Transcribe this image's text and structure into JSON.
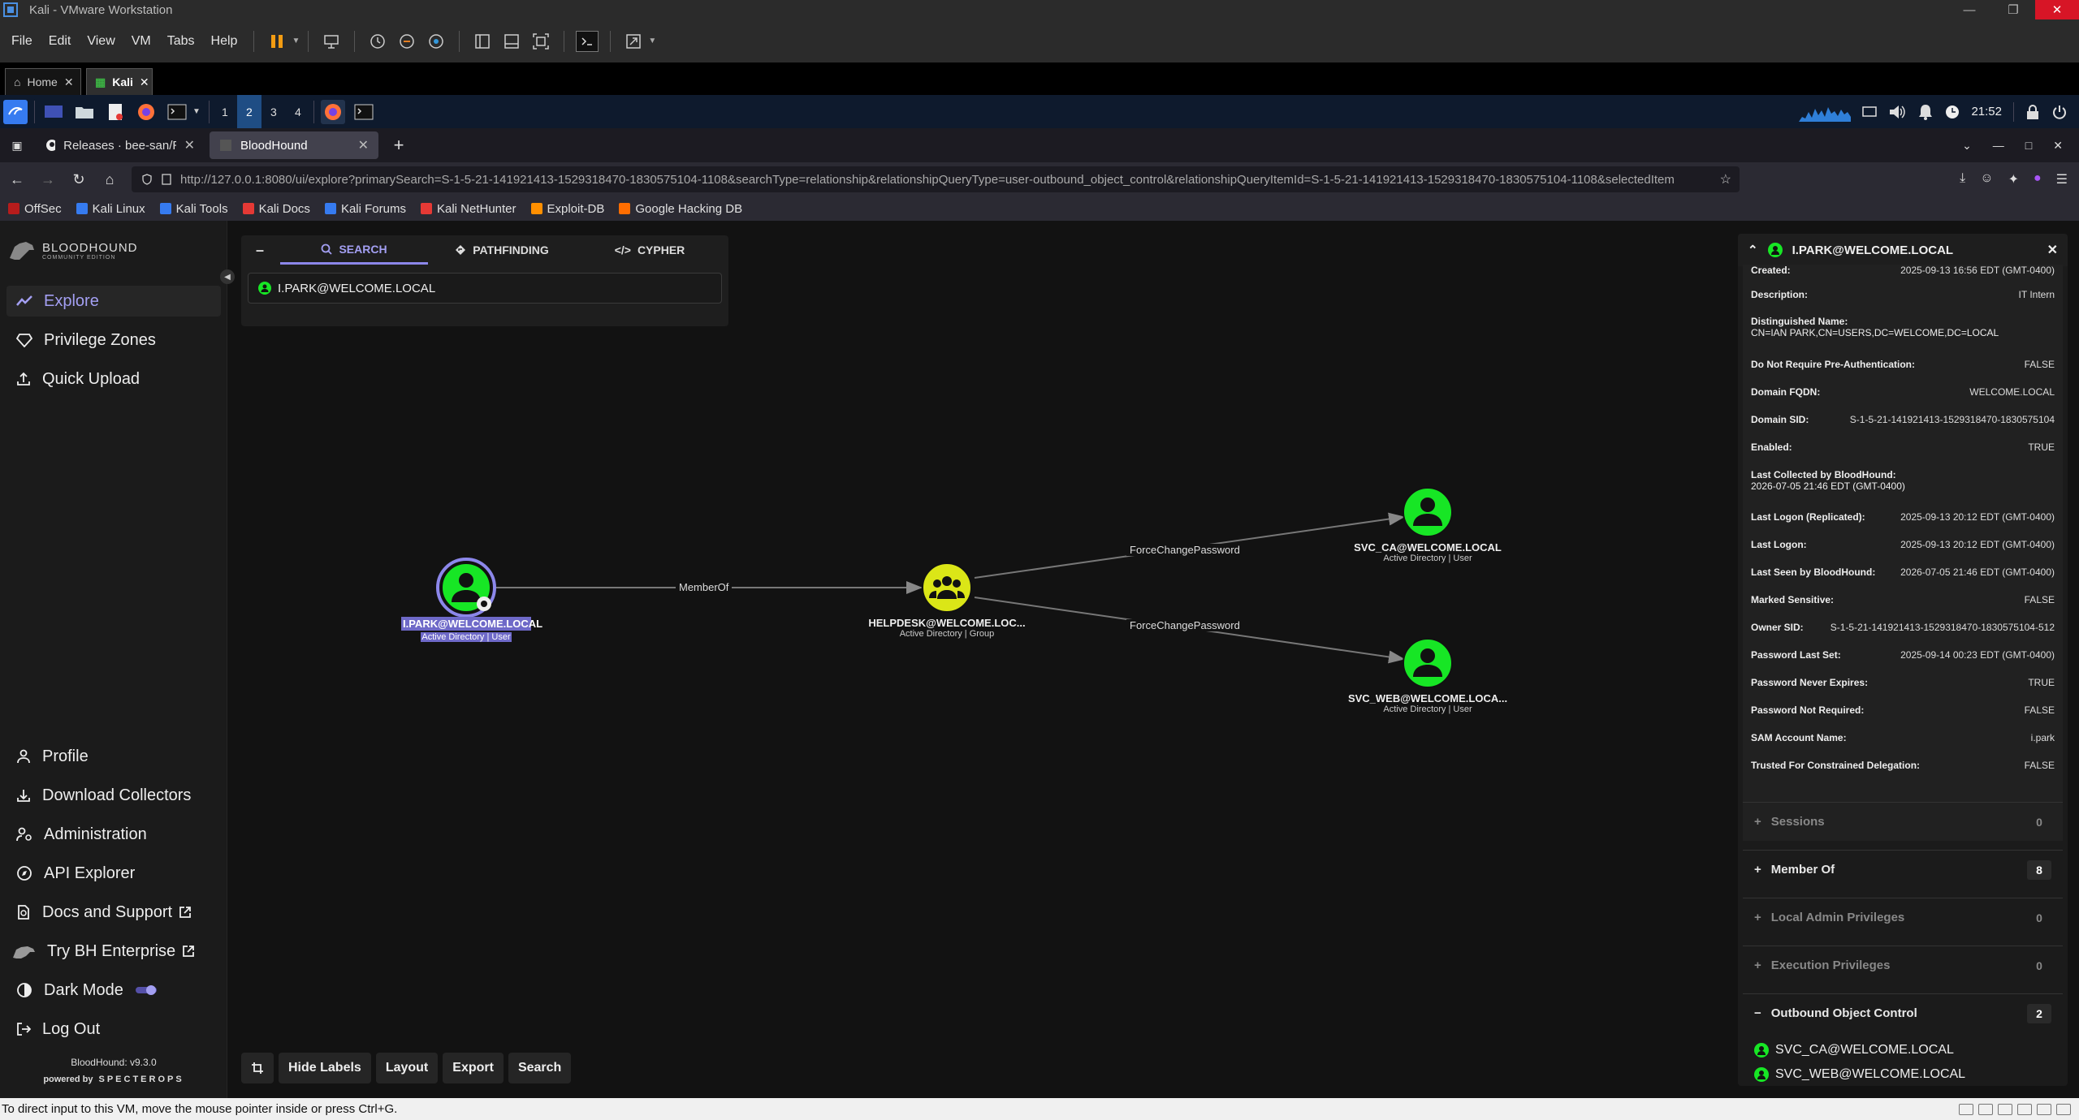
{
  "vmware": {
    "title": "Kali - VMware Workstation",
    "menu": [
      "File",
      "Edit",
      "View",
      "VM",
      "Tabs",
      "Help"
    ],
    "tabs": [
      {
        "label": "Home"
      },
      {
        "label": "Kali"
      }
    ]
  },
  "kali": {
    "workspaces": [
      "1",
      "2",
      "3",
      "4"
    ],
    "clock": "21:52"
  },
  "firefox": {
    "tabs": [
      {
        "label": "Releases · bee-san/RustSc"
      },
      {
        "label": "BloodHound"
      }
    ],
    "url": "http://127.0.0.1:8080/ui/explore?primarySearch=S-1-5-21-141921413-1529318470-1830575104-1108&searchType=relationship&relationshipQueryType=user-outbound_object_control&relationshipQueryItemId=S-1-5-21-141921413-1529318470-1830575104-1108&selectedItem",
    "bookmarks": [
      {
        "label": "OffSec",
        "color": "#b71c1c"
      },
      {
        "label": "Kali Linux",
        "color": "#367bf0"
      },
      {
        "label": "Kali Tools",
        "color": "#367bf0"
      },
      {
        "label": "Kali Docs",
        "color": "#e53935"
      },
      {
        "label": "Kali Forums",
        "color": "#367bf0"
      },
      {
        "label": "Kali NetHunter",
        "color": "#e53935"
      },
      {
        "label": "Exploit-DB",
        "color": "#ff8f00"
      },
      {
        "label": "Google Hacking DB",
        "color": "#ff6d00"
      }
    ]
  },
  "sidebar": {
    "logo_title": "BLOODHOUND",
    "logo_subtitle": "COMMUNITY EDITION",
    "top_items": [
      {
        "label": "Explore",
        "icon": "explore-icon"
      },
      {
        "label": "Privilege Zones",
        "icon": "diamond-icon"
      },
      {
        "label": "Quick Upload",
        "icon": "upload-icon"
      }
    ],
    "bottom_items": [
      {
        "label": "Profile",
        "icon": "person-icon"
      },
      {
        "label": "Download Collectors",
        "icon": "download-icon"
      },
      {
        "label": "Administration",
        "icon": "admin-icon"
      },
      {
        "label": "API Explorer",
        "icon": "compass-icon"
      },
      {
        "label": "Docs and Support",
        "icon": "docs-icon"
      },
      {
        "label": "Try BH Enterprise",
        "icon": "dog-icon"
      },
      {
        "label": "Dark Mode",
        "icon": "contrast-icon"
      },
      {
        "label": "Log Out",
        "icon": "logout-icon"
      }
    ],
    "version": "BloodHound: v9.3.0",
    "powered_by": "powered by",
    "powered_brand": "SPECTEROPS"
  },
  "search": {
    "tabs": [
      "SEARCH",
      "PATHFINDING",
      "CYPHER"
    ],
    "value": "I.PARK@WELCOME.LOCAL"
  },
  "graph": {
    "nodes": [
      {
        "label": "I.PARK@WELCOME.LOCAL",
        "sub": "Active Directory | User"
      },
      {
        "label": "HELPDESK@WELCOME.LOC...",
        "sub": "Active Directory | Group"
      },
      {
        "label": "SVC_CA@WELCOME.LOCAL",
        "sub": "Active Directory | User"
      },
      {
        "label": "SVC_WEB@WELCOME.LOCA...",
        "sub": "Active Directory | User"
      }
    ],
    "edges": [
      "MemberOf",
      "ForceChangePassword",
      "ForceChangePassword"
    ],
    "colors": {
      "user": "#17e625",
      "group": "#dbe617",
      "selected": "#8c87ea"
    }
  },
  "toolbar": {
    "buttons": [
      "Hide Labels",
      "Layout",
      "Export",
      "Search"
    ]
  },
  "panel": {
    "title": "I.PARK@WELCOME.LOCAL",
    "properties": [
      {
        "k": "Created:",
        "v": "2025-09-13 16:56 EDT (GMT-0400)"
      },
      {
        "k": "Description:",
        "v": "IT Intern"
      },
      {
        "k": "Distinguished Name:",
        "v": "CN=IAN PARK,CN=USERS,DC=WELCOME,DC=LOCAL"
      },
      {
        "k": "Do Not Require Pre-Authentication:",
        "v": "FALSE"
      },
      {
        "k": "Domain FQDN:",
        "v": "WELCOME.LOCAL"
      },
      {
        "k": "Domain SID:",
        "v": "S-1-5-21-141921413-1529318470-1830575104"
      },
      {
        "k": "Enabled:",
        "v": "TRUE"
      },
      {
        "k": "Last Collected by BloodHound:",
        "v": "2026-07-05 21:46 EDT (GMT-0400)"
      },
      {
        "k": "Last Logon (Replicated):",
        "v": "2025-09-13 20:12 EDT (GMT-0400)"
      },
      {
        "k": "Last Logon:",
        "v": "2025-09-13 20:12 EDT (GMT-0400)"
      },
      {
        "k": "Last Seen by BloodHound:",
        "v": "2026-07-05 21:46 EDT (GMT-0400)"
      },
      {
        "k": "Marked Sensitive:",
        "v": "FALSE"
      },
      {
        "k": "Owner SID:",
        "v": "S-1-5-21-141921413-1529318470-1830575104-512"
      },
      {
        "k": "Password Last Set:",
        "v": "2025-09-14 00:23 EDT (GMT-0400)"
      },
      {
        "k": "Password Never Expires:",
        "v": "TRUE"
      },
      {
        "k": "Password Not Required:",
        "v": "FALSE"
      },
      {
        "k": "SAM Account Name:",
        "v": "i.park"
      },
      {
        "k": "Trusted For Constrained Delegation:",
        "v": "FALSE"
      }
    ],
    "sections": [
      {
        "label": "Sessions",
        "count": "0",
        "toggle": "+"
      },
      {
        "label": "Member Of",
        "count": "8",
        "toggle": "+"
      },
      {
        "label": "Local Admin Privileges",
        "count": "0",
        "toggle": "+"
      },
      {
        "label": "Execution Privileges",
        "count": "0",
        "toggle": "+"
      },
      {
        "label": "Outbound Object Control",
        "count": "2",
        "toggle": "−"
      }
    ],
    "outbound_items": [
      "SVC_CA@WELCOME.LOCAL",
      "SVC_WEB@WELCOME.LOCAL"
    ]
  },
  "statusbar": {
    "text": "To direct input to this VM, move the mouse pointer inside or press Ctrl+G."
  }
}
